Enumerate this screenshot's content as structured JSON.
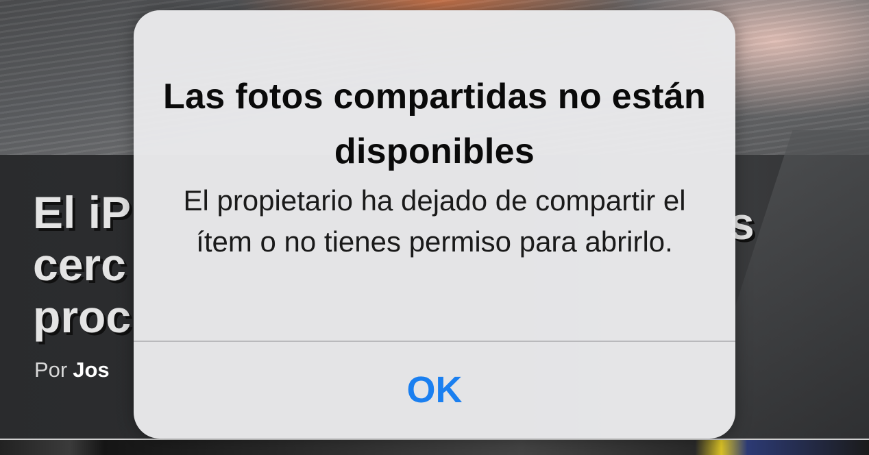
{
  "background_article": {
    "title_fragment": "El iP\ncerc\nproc",
    "title_tail": "s",
    "byline_prefix": "Por",
    "byline_author": "Jos"
  },
  "alert": {
    "title": "Las fotos compartidas no están disponibles",
    "message": "El propietario ha dejado de compartir el ítem o no tienes permiso para abrirlo.",
    "ok_button_label": "OK"
  },
  "colors": {
    "accent": "#1a7ff0",
    "alert_background": "#e8e8ea",
    "dim_background": "#2f3032"
  }
}
